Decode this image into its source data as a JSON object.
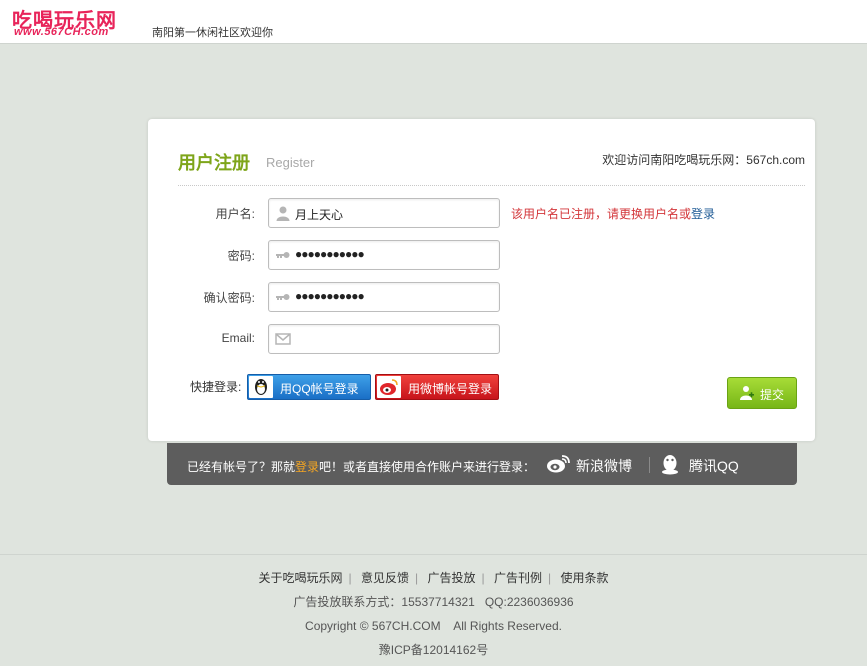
{
  "header": {
    "logo_cn": "吃喝玩乐网",
    "logo_url": "www.567CH.com",
    "tagline": "南阳第一休闲社区欢迎你"
  },
  "register": {
    "title": "用户注册",
    "subtitle": "Register",
    "welcome": "欢迎访问南阳吃喝玩乐网：567ch.com",
    "fields": {
      "username": {
        "label": "用户名:",
        "value": "月上天心",
        "icon": "user-icon"
      },
      "password": {
        "label": "密码:",
        "value": "●●●●●●●●●●●",
        "icon": "key-icon"
      },
      "confirm": {
        "label": "确认密码:",
        "value": "●●●●●●●●●●●",
        "icon": "key-icon"
      },
      "email": {
        "label": "Email:",
        "value": "",
        "icon": "envelope-icon"
      }
    },
    "error_text": "该用户名已注册，请更换用户名或",
    "error_link": "登录",
    "quick_login_label": "快捷登录:",
    "qq_button": "用QQ帐号登录",
    "weibo_button": "用微博帐号登录",
    "submit_button": "提交"
  },
  "alt_login": {
    "text_before": "已经有帐号了？那就",
    "login_link": "登录",
    "text_after": "吧！或者直接使用合作账户来进行登录：",
    "weibo": "新浪微博",
    "tqq": "腾讯QQ"
  },
  "footer": {
    "links": [
      "关于吃喝玩乐网",
      "意见反馈",
      "广告投放",
      "广告刊例",
      "使用条款"
    ],
    "contact": "广告投放联系方式：15537714321   QQ:2236036936",
    "copyright": "Copyright © 567CH.COM    All Rights Reserved.",
    "icp": "豫ICP备12014162号"
  },
  "colors": {
    "accent_green": "#7ea51a",
    "error_red": "#d3363a",
    "submit_green": "#8cc925",
    "qq_blue": "#2a85d8",
    "weibo_red": "#e0262b",
    "bar_gray": "#5d5d5d"
  }
}
